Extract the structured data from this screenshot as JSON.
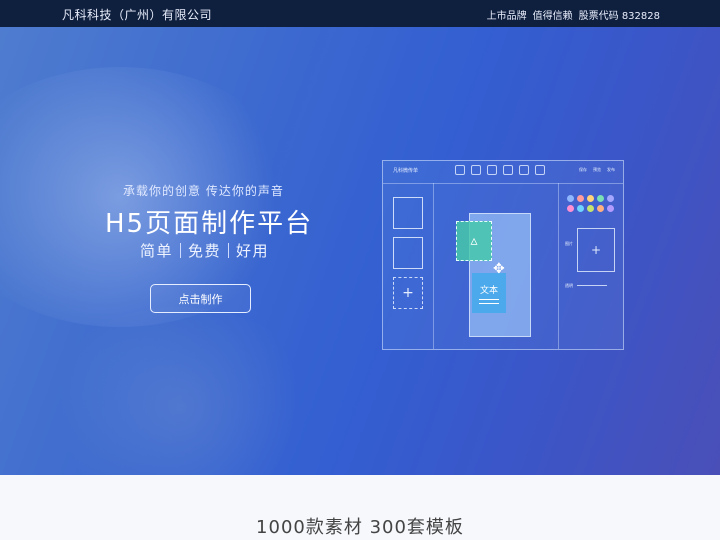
{
  "header": {
    "brand": "凡科科技（广州）有限公司",
    "links": [
      "上市品牌",
      "值得信赖",
      "股票代码 832828"
    ]
  },
  "hero": {
    "tagline": "承载你的创意 传达你的声音",
    "title": "H5页面制作平台",
    "subtitle": [
      "简单",
      "免费",
      "好用"
    ],
    "cta_label": "点击制作"
  },
  "mockup": {
    "logo_text": "凡科微传单",
    "actions": [
      "保存",
      "预览",
      "发布"
    ],
    "text_card_label": "文本",
    "prop_labels": [
      "图片",
      "透明"
    ],
    "swatch_colors": [
      "#8fb7ff",
      "#ff9c9c",
      "#ffd37a",
      "#7be0b4",
      "#a4a6ff",
      "#ff8fd1",
      "#6fd4ff",
      "#c4e46f",
      "#ffb080",
      "#b49cff"
    ]
  },
  "features": {
    "title": "1000款素材 300套模板"
  }
}
